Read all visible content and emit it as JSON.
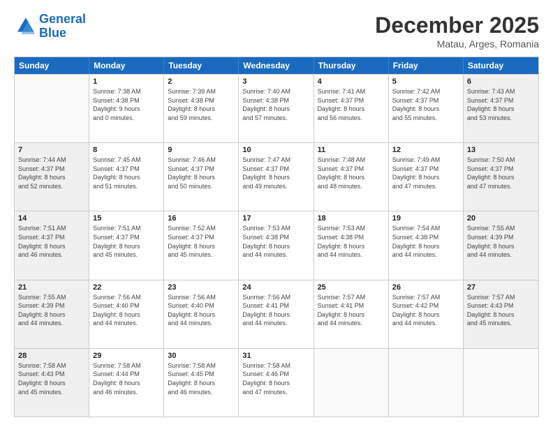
{
  "header": {
    "logo_line1": "General",
    "logo_line2": "Blue",
    "month_title": "December 2025",
    "location": "Matau, Arges, Romania"
  },
  "days_of_week": [
    "Sunday",
    "Monday",
    "Tuesday",
    "Wednesday",
    "Thursday",
    "Friday",
    "Saturday"
  ],
  "weeks": [
    [
      {
        "day": "",
        "info": "",
        "empty": true
      },
      {
        "day": "1",
        "info": "Sunrise: 7:38 AM\nSunset: 4:38 PM\nDaylight: 9 hours\nand 0 minutes."
      },
      {
        "day": "2",
        "info": "Sunrise: 7:39 AM\nSunset: 4:38 PM\nDaylight: 8 hours\nand 59 minutes."
      },
      {
        "day": "3",
        "info": "Sunrise: 7:40 AM\nSunset: 4:38 PM\nDaylight: 8 hours\nand 57 minutes."
      },
      {
        "day": "4",
        "info": "Sunrise: 7:41 AM\nSunset: 4:37 PM\nDaylight: 8 hours\nand 56 minutes."
      },
      {
        "day": "5",
        "info": "Sunrise: 7:42 AM\nSunset: 4:37 PM\nDaylight: 8 hours\nand 55 minutes."
      },
      {
        "day": "6",
        "info": "Sunrise: 7:43 AM\nSunset: 4:37 PM\nDaylight: 8 hours\nand 53 minutes.",
        "shaded": true
      }
    ],
    [
      {
        "day": "7",
        "info": "Sunrise: 7:44 AM\nSunset: 4:37 PM\nDaylight: 8 hours\nand 52 minutes.",
        "shaded": true
      },
      {
        "day": "8",
        "info": "Sunrise: 7:45 AM\nSunset: 4:37 PM\nDaylight: 8 hours\nand 51 minutes."
      },
      {
        "day": "9",
        "info": "Sunrise: 7:46 AM\nSunset: 4:37 PM\nDaylight: 8 hours\nand 50 minutes."
      },
      {
        "day": "10",
        "info": "Sunrise: 7:47 AM\nSunset: 4:37 PM\nDaylight: 8 hours\nand 49 minutes."
      },
      {
        "day": "11",
        "info": "Sunrise: 7:48 AM\nSunset: 4:37 PM\nDaylight: 8 hours\nand 48 minutes."
      },
      {
        "day": "12",
        "info": "Sunrise: 7:49 AM\nSunset: 4:37 PM\nDaylight: 8 hours\nand 47 minutes."
      },
      {
        "day": "13",
        "info": "Sunrise: 7:50 AM\nSunset: 4:37 PM\nDaylight: 8 hours\nand 47 minutes.",
        "shaded": true
      }
    ],
    [
      {
        "day": "14",
        "info": "Sunrise: 7:51 AM\nSunset: 4:37 PM\nDaylight: 8 hours\nand 46 minutes.",
        "shaded": true
      },
      {
        "day": "15",
        "info": "Sunrise: 7:51 AM\nSunset: 4:37 PM\nDaylight: 8 hours\nand 45 minutes."
      },
      {
        "day": "16",
        "info": "Sunrise: 7:52 AM\nSunset: 4:37 PM\nDaylight: 8 hours\nand 45 minutes."
      },
      {
        "day": "17",
        "info": "Sunrise: 7:53 AM\nSunset: 4:38 PM\nDaylight: 8 hours\nand 44 minutes."
      },
      {
        "day": "18",
        "info": "Sunrise: 7:53 AM\nSunset: 4:38 PM\nDaylight: 8 hours\nand 44 minutes."
      },
      {
        "day": "19",
        "info": "Sunrise: 7:54 AM\nSunset: 4:38 PM\nDaylight: 8 hours\nand 44 minutes."
      },
      {
        "day": "20",
        "info": "Sunrise: 7:55 AM\nSunset: 4:39 PM\nDaylight: 8 hours\nand 44 minutes.",
        "shaded": true
      }
    ],
    [
      {
        "day": "21",
        "info": "Sunrise: 7:55 AM\nSunset: 4:39 PM\nDaylight: 8 hours\nand 44 minutes.",
        "shaded": true
      },
      {
        "day": "22",
        "info": "Sunrise: 7:56 AM\nSunset: 4:40 PM\nDaylight: 8 hours\nand 44 minutes."
      },
      {
        "day": "23",
        "info": "Sunrise: 7:56 AM\nSunset: 4:40 PM\nDaylight: 8 hours\nand 44 minutes."
      },
      {
        "day": "24",
        "info": "Sunrise: 7:56 AM\nSunset: 4:41 PM\nDaylight: 8 hours\nand 44 minutes."
      },
      {
        "day": "25",
        "info": "Sunrise: 7:57 AM\nSunset: 4:41 PM\nDaylight: 8 hours\nand 44 minutes."
      },
      {
        "day": "26",
        "info": "Sunrise: 7:57 AM\nSunset: 4:42 PM\nDaylight: 8 hours\nand 44 minutes."
      },
      {
        "day": "27",
        "info": "Sunrise: 7:57 AM\nSunset: 4:43 PM\nDaylight: 8 hours\nand 45 minutes.",
        "shaded": true
      }
    ],
    [
      {
        "day": "28",
        "info": "Sunrise: 7:58 AM\nSunset: 4:43 PM\nDaylight: 8 hours\nand 45 minutes.",
        "shaded": true
      },
      {
        "day": "29",
        "info": "Sunrise: 7:58 AM\nSunset: 4:44 PM\nDaylight: 8 hours\nand 46 minutes."
      },
      {
        "day": "30",
        "info": "Sunrise: 7:58 AM\nSunset: 4:45 PM\nDaylight: 8 hours\nand 46 minutes."
      },
      {
        "day": "31",
        "info": "Sunrise: 7:58 AM\nSunset: 4:46 PM\nDaylight: 8 hours\nand 47 minutes."
      },
      {
        "day": "",
        "info": "",
        "empty": true
      },
      {
        "day": "",
        "info": "",
        "empty": true
      },
      {
        "day": "",
        "info": "",
        "empty": true,
        "shaded": true
      }
    ]
  ]
}
